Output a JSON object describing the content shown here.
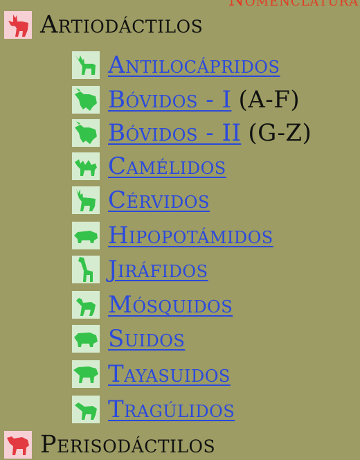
{
  "header_clipped_text": "Nomenclatura",
  "groups": [
    {
      "label": "Artiodáctilos",
      "icon": "deer-icon-red",
      "children": [
        {
          "label": "Antilocápridos",
          "suffix": "",
          "icon": "pronghorn-icon"
        },
        {
          "label": "Bóvidos - I",
          "suffix": "(A-F)",
          "icon": "bovid-icon"
        },
        {
          "label": "Bóvidos - II",
          "suffix": "(G-Z)",
          "icon": "bovid-icon"
        },
        {
          "label": "Camélidos",
          "suffix": "",
          "icon": "camel-icon"
        },
        {
          "label": "Cérvidos",
          "suffix": "",
          "icon": "deer-icon"
        },
        {
          "label": "Hipopotámidos",
          "suffix": "",
          "icon": "hippo-icon"
        },
        {
          "label": "Jiráfidos",
          "suffix": "",
          "icon": "giraffe-icon"
        },
        {
          "label": "Mósquidos",
          "suffix": "",
          "icon": "musk-deer-icon"
        },
        {
          "label": "Suidos",
          "suffix": "",
          "icon": "pig-icon"
        },
        {
          "label": "Tayasuidos",
          "suffix": "",
          "icon": "peccary-icon"
        },
        {
          "label": "Tragúlidos",
          "suffix": "",
          "icon": "chevrotain-icon"
        }
      ]
    },
    {
      "label": "Perisodáctilos",
      "icon": "horse-icon-red",
      "children": []
    }
  ],
  "colors": {
    "background": "#9c9c64",
    "link": "#2a49dd",
    "text": "#111111",
    "icon_green": "#35c24a",
    "icon_green_bg": "#cfe8c7",
    "icon_red": "#e23a40",
    "icon_red_bg": "#f7cfd1"
  }
}
